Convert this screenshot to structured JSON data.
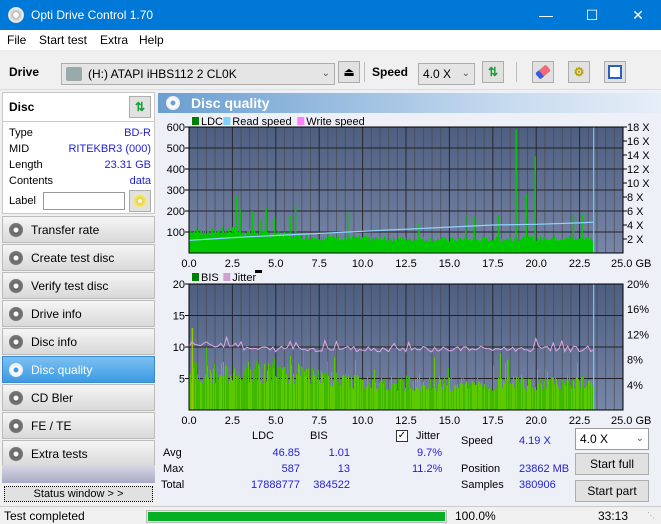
{
  "window": {
    "title": "Opti Drive Control 1.70",
    "minimize": "—",
    "maximize": "☐",
    "close": "✕"
  },
  "menu": [
    "File",
    "Start test",
    "Extra",
    "Help"
  ],
  "toolbar": {
    "drive_label": "Drive",
    "drive_value": "(H:)  ATAPI iHBS112  2 CL0K",
    "speed_label": "Speed",
    "speed_value": "4.0 X"
  },
  "disc": {
    "header": "Disc",
    "type_label": "Type",
    "type_value": "BD-R",
    "mid_label": "MID",
    "mid_value": "RITEKBR3 (000)",
    "length_label": "Length",
    "length_value": "23.31 GB",
    "contents_label": "Contents",
    "contents_value": "data",
    "label_label": "Label",
    "label_value": ""
  },
  "nav": [
    {
      "label": "Transfer rate"
    },
    {
      "label": "Create test disc"
    },
    {
      "label": "Verify test disc"
    },
    {
      "label": "Drive info"
    },
    {
      "label": "Disc info"
    },
    {
      "label": "Disc quality",
      "active": true
    },
    {
      "label": "CD Bler"
    },
    {
      "label": "FE / TE"
    },
    {
      "label": "Extra tests"
    }
  ],
  "status_window_label": "Status window > >",
  "panel_title": "Disc quality",
  "chart_data": [
    {
      "type": "bar",
      "title": "LDC",
      "legend": [
        "LDC",
        "Read speed",
        "Write speed"
      ],
      "legend_colors": [
        "#008000",
        "#7fcfff",
        "#ff80ff"
      ],
      "x_ticks": [
        "0.0",
        "2.5",
        "5.0",
        "7.5",
        "10.0",
        "12.5",
        "15.0",
        "17.5",
        "20.0",
        "22.5",
        "25.0 GB"
      ],
      "xlim": [
        0,
        25
      ],
      "y_ticks": [
        "100",
        "200",
        "300",
        "400",
        "500",
        "600"
      ],
      "ylim": [
        0,
        600
      ],
      "y2_ticks": [
        "2 X",
        "4 X",
        "6 X",
        "8 X",
        "10 X",
        "12 X",
        "14 X",
        "16 X",
        "18 X"
      ],
      "y2lim": [
        0,
        18
      ],
      "ldc_baseline": [
        [
          0,
          110
        ],
        [
          2.5,
          115
        ],
        [
          5,
          95
        ],
        [
          7.5,
          80
        ],
        [
          10,
          75
        ],
        [
          12.5,
          72
        ],
        [
          15,
          70
        ],
        [
          17.5,
          72
        ],
        [
          20,
          75
        ],
        [
          22.5,
          75
        ],
        [
          23.31,
          75
        ]
      ],
      "ldc_spikes": [
        [
          2.7,
          270
        ],
        [
          2.9,
          210
        ],
        [
          3.6,
          200
        ],
        [
          4.1,
          160
        ],
        [
          4.4,
          220
        ],
        [
          4.9,
          170
        ],
        [
          5.8,
          175
        ],
        [
          6.1,
          230
        ],
        [
          9.1,
          195
        ],
        [
          13.2,
          140
        ],
        [
          15.9,
          180
        ],
        [
          16.4,
          170
        ],
        [
          17.8,
          180
        ],
        [
          18.8,
          587
        ],
        [
          19.4,
          280
        ],
        [
          19.9,
          460
        ],
        [
          22.1,
          180
        ],
        [
          22.6,
          185
        ]
      ],
      "read_speed": [
        [
          0,
          1.8
        ],
        [
          2.5,
          2.2
        ],
        [
          5,
          2.5
        ],
        [
          7.5,
          2.8
        ],
        [
          10,
          3.1
        ],
        [
          12.5,
          3.4
        ],
        [
          15,
          3.7
        ],
        [
          17.5,
          4.0
        ],
        [
          20,
          4.1
        ],
        [
          22.5,
          4.3
        ],
        [
          23.31,
          4.4
        ]
      ],
      "end_marker": 23.31
    },
    {
      "type": "bar",
      "title": "BIS",
      "legend": [
        "BIS",
        "Jitter"
      ],
      "legend_colors": [
        "#008000",
        "#d0a0d0"
      ],
      "x_ticks": [
        "0.0",
        "2.5",
        "5.0",
        "7.5",
        "10.0",
        "12.5",
        "15.0",
        "17.5",
        "20.0",
        "22.5",
        "25.0 GB"
      ],
      "xlim": [
        0,
        25
      ],
      "y_ticks": [
        "5",
        "10",
        "15",
        "20"
      ],
      "ylim": [
        0,
        20
      ],
      "y2_ticks": [
        "4%",
        "8%",
        "12%",
        "16%",
        "20%"
      ],
      "y2lim": [
        0,
        20
      ],
      "bis_typical": [
        [
          0,
          7
        ],
        [
          2.5,
          7
        ],
        [
          5,
          7
        ],
        [
          7.5,
          6
        ],
        [
          10,
          5
        ],
        [
          12.5,
          5
        ],
        [
          15,
          5
        ],
        [
          17.5,
          5
        ],
        [
          20,
          5
        ],
        [
          22.5,
          5
        ],
        [
          23.31,
          5
        ]
      ],
      "bis_max": 13,
      "jitter_avg": 9.7,
      "jitter_max": 11.2,
      "end_marker": 23.31
    }
  ],
  "stats": {
    "col_ldc": "LDC",
    "col_bis": "BIS",
    "row_avg": "Avg",
    "row_max": "Max",
    "row_total": "Total",
    "avg_ldc": "46.85",
    "avg_bis": "1.01",
    "max_ldc": "587",
    "max_bis": "13",
    "total_ldc": "17888777",
    "total_bis": "384522",
    "jitter_label": "Jitter",
    "jitter_checked": true,
    "jitter_avg": "9.7%",
    "jitter_max": "11.2%",
    "speed_label": "Speed",
    "speed_value": "4.19 X",
    "position_label": "Position",
    "position_value": "23862 MB",
    "samples_label": "Samples",
    "samples_value": "380906",
    "speed_select": "4.0 X",
    "start_full": "Start full",
    "start_part": "Start part"
  },
  "statusbar": {
    "text": "Test completed",
    "progress": 100.0,
    "progress_text": "100.0%",
    "time": "33:13"
  }
}
